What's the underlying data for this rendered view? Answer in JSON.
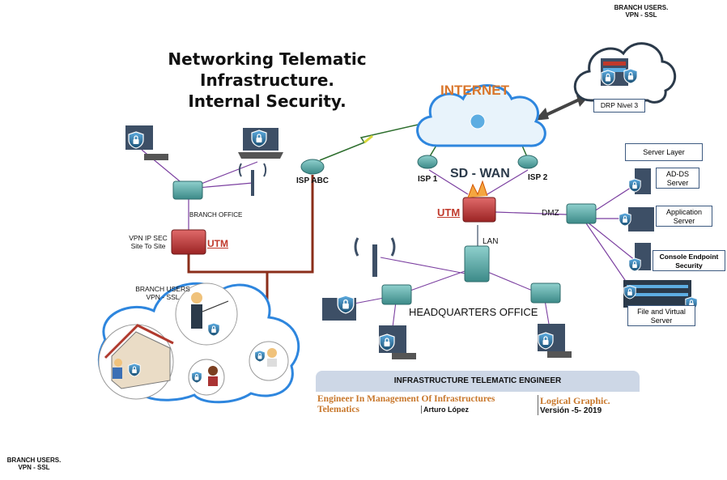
{
  "title": {
    "line1": "Networking Telematic Infrastructure.",
    "line2": "Internal Security."
  },
  "labels": {
    "internet": "INTERNET",
    "sdwan": "SD - WAN",
    "isp_abc": "ISP  ABC",
    "isp1": "ISP 1",
    "isp2": "ISP 2",
    "utm_hq": "UTM",
    "utm_branch": "UTM",
    "dmz": "DMZ",
    "lan": "LAN",
    "headquarters": "HEADQUARTERS OFFICE",
    "branch_office": "BRANCH OFFICE",
    "vpn_ipsec_1": "VPN IP SEC",
    "vpn_ipsec_2": "Site To Site",
    "branch_users_cloud_1": "BRANCH USERS",
    "branch_users_cloud_2": "VPN - SSL",
    "branch_users_top_1": "BRANCH USERS.",
    "branch_users_top_2": "VPN - SSL",
    "branch_users_bottom_1": "BRANCH USERS.",
    "branch_users_bottom_2": "VPN - SSL",
    "drp": "DRP Nivel 3"
  },
  "servers": {
    "server_layer": "Server Layer",
    "ad_ds_1": "AD-DS",
    "ad_ds_2": "Server",
    "application_1": "Application",
    "application_2": "Server",
    "console_1": "Console Endpoint",
    "console_2": "Security",
    "file_1": "File and Virtual",
    "file_2": "Server"
  },
  "footer": {
    "heading": "INFRASTRUCTURE TELEMATIC ENGINEER",
    "engineer_1": "Engineer In Management Of Infrastructures",
    "engineer_2": "Telematics",
    "author": "Arturo López",
    "graphic": "Logical Graphic.",
    "version": "Versión -5- 2019"
  },
  "colors": {
    "brown_link": "#8b2e1a",
    "purple_link": "#7b3fa0",
    "accent_orange": "#d9762b",
    "utm_red": "#c0392b",
    "cloud_blue": "#2e86de",
    "device_teal": "#4a9a9a"
  },
  "icons": [
    "shield-lock-icon",
    "router-icon",
    "switch-icon",
    "firewall-icon",
    "cloud-icon",
    "laptop-icon",
    "workstation-icon",
    "server-icon",
    "wifi-icon",
    "user-icon",
    "house-icon",
    "lightning-icon",
    "double-arrow-icon"
  ]
}
